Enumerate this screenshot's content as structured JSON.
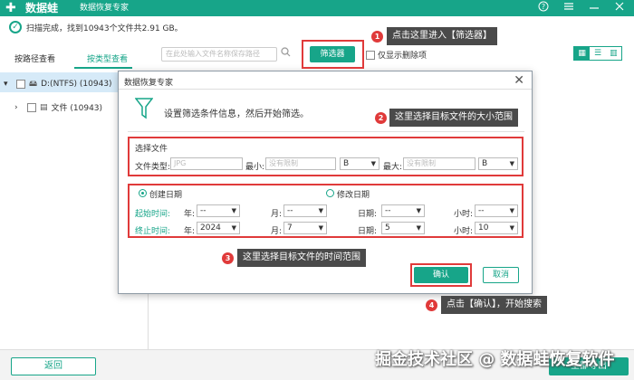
{
  "titlebar": {
    "logo": "✚",
    "app_name": "数据蛙",
    "subtitle": "数据恢复专家",
    "icons": [
      "help-icon",
      "menu-icon",
      "minimize-icon",
      "close-icon"
    ]
  },
  "status": {
    "text": "扫描完成，找到10943个文件共2.91 GB。"
  },
  "tabs": {
    "by_path": "按路径查看",
    "by_type": "按类型查看"
  },
  "search": {
    "placeholder": "在此处输入文件名称保存路径"
  },
  "toolbar": {
    "filter_label": "筛选器",
    "only_deleted_label": "仅显示删除项",
    "view_options": [
      "",
      "",
      ""
    ]
  },
  "tree": {
    "drive_label": "D:(NTFS) (10943)",
    "folder_label": "文件 (10943)"
  },
  "dialog": {
    "title": "数据恢复专家",
    "info": "设置筛选条件信息，然后开始筛选。",
    "file_section_title": "选择文件",
    "file_type_label": "文件类型:",
    "file_type_placeholder": "JPG",
    "min_label": "最小:",
    "min_placeholder": "没有限制",
    "min_unit": "B",
    "max_label": "最大:",
    "max_placeholder": "没有限制",
    "max_unit": "B",
    "created_date_label": "创建日期",
    "modified_date_label": "修改日期",
    "start_time_label": "起始时间:",
    "end_time_label": "终止时间:",
    "year_label": "年:",
    "month_label": "月:",
    "day_label": "日期:",
    "hour_label": "小时:",
    "start": {
      "year": "--",
      "month": "--",
      "day": "--",
      "hour": "--"
    },
    "end": {
      "year": "2024",
      "month": "7",
      "day": "5",
      "hour": "10"
    },
    "ok_label": "确认",
    "cancel_label": "取消"
  },
  "annotations": {
    "step1_num": "1",
    "step1_text": "点击这里进入【筛选器】",
    "step2_num": "2",
    "step2_text": "这里选择目标文件的大小范围",
    "step3_num": "3",
    "step3_text": "这里选择目标文件的时间范围",
    "step4_num": "4",
    "step4_text": "点击【确认】，开始搜索"
  },
  "footer": {
    "back_label": "返回",
    "export_label": "全部导出"
  },
  "watermark": "掘金技术社区 @ 数据蛙恢复软件",
  "colors": {
    "brand": "#17a589",
    "annotation": "#e03a3a",
    "callout_bg": "#4a4a4a"
  }
}
